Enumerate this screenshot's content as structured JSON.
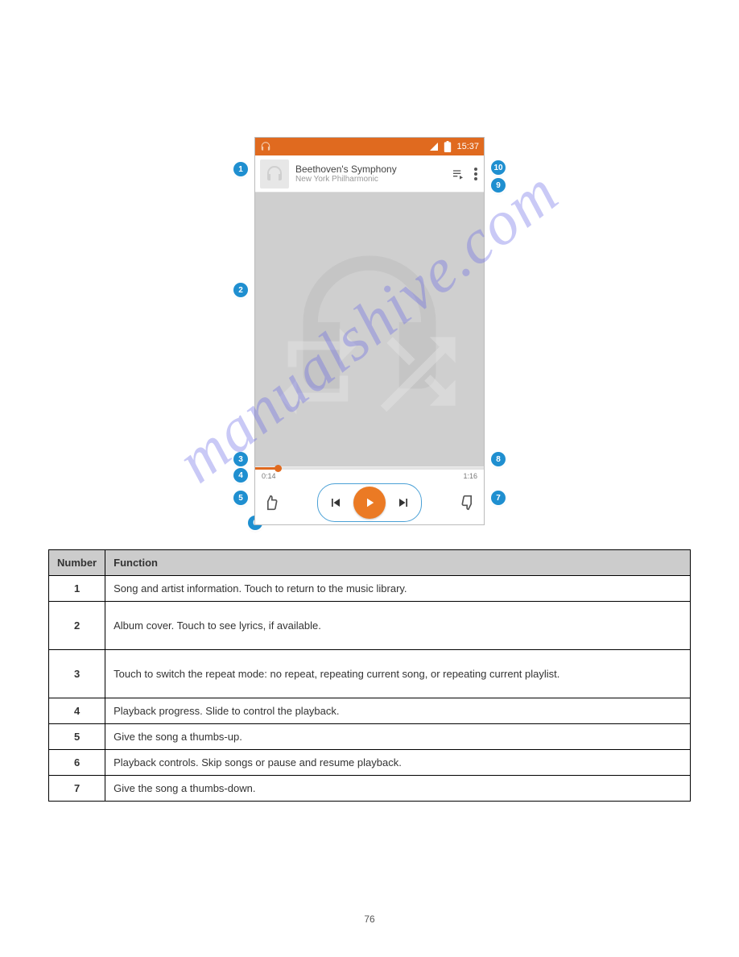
{
  "statusbar": {
    "time": "15:37"
  },
  "track": {
    "title": "Beethoven's Symphony",
    "artist": "New York Philharmonic"
  },
  "progress": {
    "elapsed": "0:14",
    "total": "1:16",
    "percent": 10
  },
  "callouts": [
    {
      "n": "1"
    },
    {
      "n": "2"
    },
    {
      "n": "3"
    },
    {
      "n": "4"
    },
    {
      "n": "5"
    },
    {
      "n": "6"
    },
    {
      "n": "7"
    },
    {
      "n": "8"
    },
    {
      "n": "9"
    },
    {
      "n": "10"
    }
  ],
  "legend": {
    "headers": {
      "number": "Number",
      "function": "Function"
    },
    "rows": [
      {
        "num": "1",
        "func": "Song and artist information. Touch to return to the music library.",
        "tall": false
      },
      {
        "num": "2",
        "func": "Album cover. Touch to see lyrics, if available.",
        "tall": true
      },
      {
        "num": "3",
        "func": "Touch to switch the repeat mode: no repeat, repeating current song, or repeating current playlist.",
        "tall": true
      },
      {
        "num": "4",
        "func": "Playback progress. Slide to control the playback.",
        "tall": false
      },
      {
        "num": "5",
        "func": "Give the song a thumbs-up.",
        "tall": false
      },
      {
        "num": "6",
        "func": "Playback controls. Skip songs or pause and resume playback.",
        "tall": false
      },
      {
        "num": "7",
        "func": "Give the song a thumbs-down.",
        "tall": false
      }
    ]
  },
  "watermark_text": "manualshive.com",
  "page_number": "76"
}
